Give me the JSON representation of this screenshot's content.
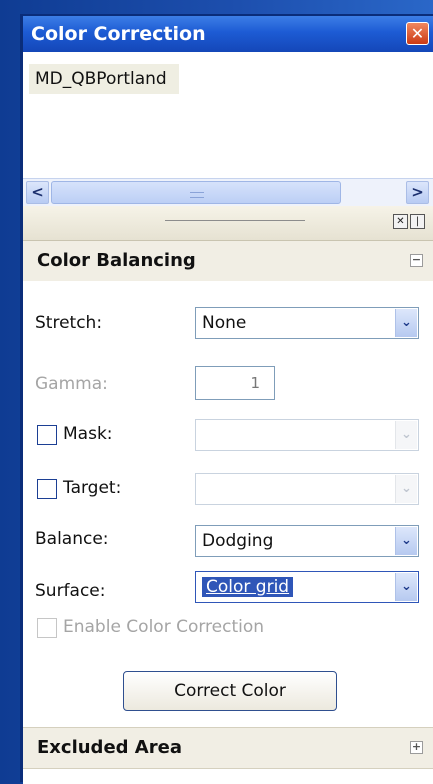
{
  "window": {
    "title": "Color Correction",
    "close_glyph": "✕"
  },
  "list": {
    "items": [
      "MD_QBPortland"
    ]
  },
  "hscroll": {
    "left_glyph": "<",
    "right_glyph": ">"
  },
  "splitter": {
    "pin_glyph": "✕",
    "menu_glyph": "|"
  },
  "color_balancing": {
    "title": "Color Balancing",
    "collapse_glyph": "−",
    "stretch": {
      "label": "Stretch:",
      "value": "None"
    },
    "gamma": {
      "label": "Gamma:",
      "value": "1"
    },
    "mask": {
      "label": "Mask:",
      "value": ""
    },
    "target": {
      "label": "Target:",
      "value": ""
    },
    "balance": {
      "label": "Balance:",
      "value": "Dodging"
    },
    "surface": {
      "label": "Surface:",
      "value": "Color grid"
    },
    "enable_label": "Enable Color Correction",
    "button_label": "Correct Color",
    "dropdown_glyph": "⌄"
  },
  "excluded_area": {
    "title": "Excluded Area",
    "expand_glyph": "+"
  },
  "colors": {
    "titlebar": "#1d5bd4",
    "selection": "#2f56b8",
    "border": "#7f9db9"
  }
}
